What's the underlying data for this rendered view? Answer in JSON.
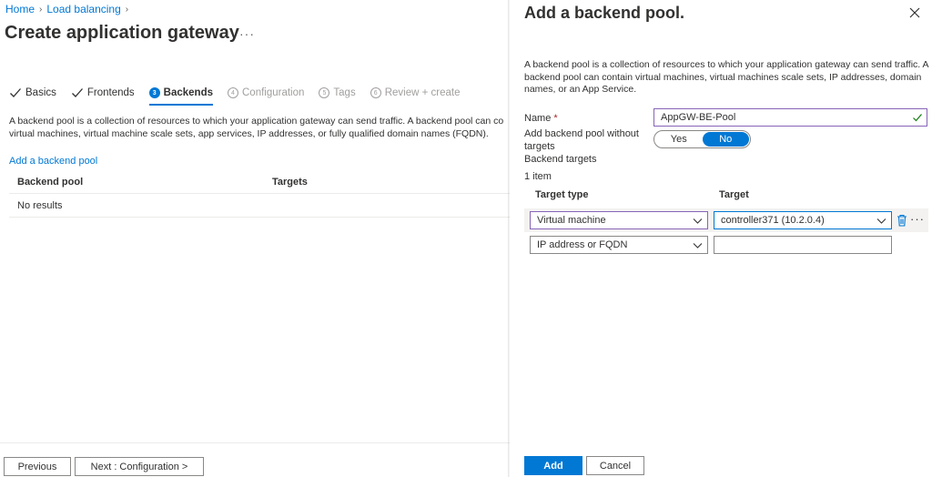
{
  "breadcrumb": {
    "home": "Home",
    "load_balancing": "Load balancing"
  },
  "page": {
    "title": "Create application gateway",
    "more": "···"
  },
  "tabs": [
    {
      "label": "Basics",
      "state": "done"
    },
    {
      "label": "Frontends",
      "state": "done"
    },
    {
      "label": "Backends",
      "state": "active",
      "step": "3"
    },
    {
      "label": "Configuration",
      "state": "disabled",
      "step": "4"
    },
    {
      "label": "Tags",
      "state": "disabled",
      "step": "5"
    },
    {
      "label": "Review + create",
      "state": "disabled",
      "step": "6"
    }
  ],
  "left": {
    "description_line1": "A backend pool is a collection of resources to which your application gateway can send traffic. A backend pool can co",
    "description_line2": "virtual machines, virtual machine scale sets, app services, IP addresses, or fully qualified domain names (FQDN).",
    "add_link": "Add a backend pool",
    "grid": {
      "col1": "Backend pool",
      "col2": "Targets",
      "empty": "No results"
    }
  },
  "footer": {
    "previous": "Previous",
    "next": "Next : Configuration >"
  },
  "panel": {
    "title": "Add a backend pool.",
    "description": "A backend pool is a collection of resources to which your application gateway can send traffic. A backend pool can contain virtual machines, virtual machines scale sets, IP addresses, domain names, or an App Service.",
    "name_label": "Name",
    "required_mark": "*",
    "name_value": "AppGW-BE-Pool",
    "without_targets_label": "Add backend pool without targets",
    "toggle": {
      "yes": "Yes",
      "no": "No",
      "selected": "No"
    },
    "backend_targets_label": "Backend targets",
    "item_count": "1 item",
    "table": {
      "col_type": "Target type",
      "col_target": "Target",
      "rows": [
        {
          "type": "Virtual machine",
          "target": "controller371 (10.2.0.4)"
        },
        {
          "type": "IP address or FQDN",
          "target": ""
        }
      ]
    },
    "more": "···",
    "add_button": "Add",
    "cancel_button": "Cancel"
  },
  "colors": {
    "accent": "#0078d4",
    "focus_purple": "#8764b8",
    "required": "#a4262c"
  }
}
